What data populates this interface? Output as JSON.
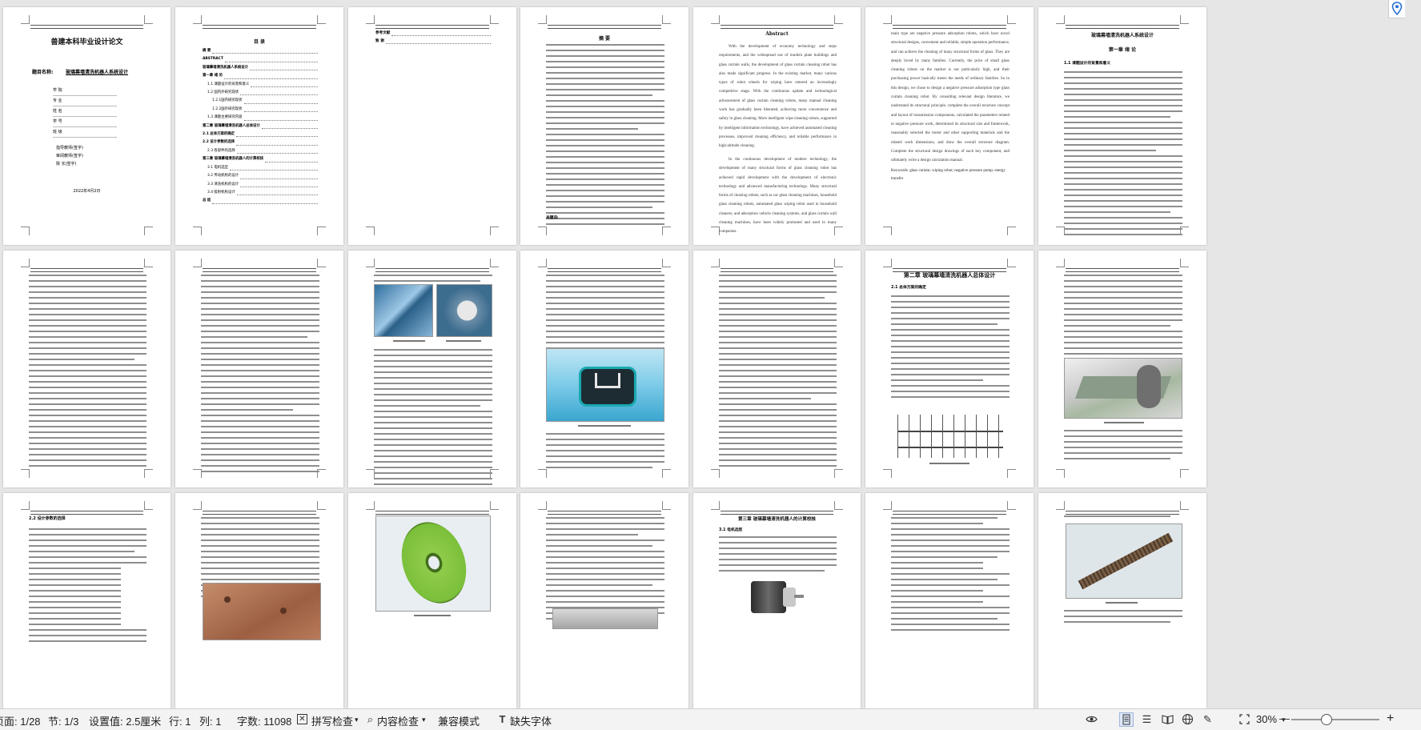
{
  "pages": {
    "cover": {
      "title": "兽建本科毕业设计论文",
      "topic_label": "题目名称:",
      "topic": "玻璃幕墙清洗机器人系统设计",
      "fields": [
        "学 院",
        "专 业",
        "姓 名",
        "学 号",
        "班 级"
      ],
      "signatures": [
        "指导教师(签字)",
        "审阅教师(签字)",
        "院 长(签字)"
      ],
      "date": "2022年4月2日"
    },
    "toc": {
      "title": "目 录",
      "entries": [
        "摘 要",
        "ABSTRACT",
        "玻璃幕墙清洗机器人系统设计",
        "第一章 绪 论",
        "1.1 课题设计的背景和意义",
        "1.2 国内外研究现状",
        "1.2.1国内研究现状",
        "1.2.2国外研究现状",
        "1.3 课题主要研究内容",
        "第二章 玻璃幕墙清洗机器人总体设计",
        "2.1 总体方案的确定",
        "2.2 设计参数的选择",
        "2.3 各部件的选择",
        "第三章 玻璃幕墙清洗机器人的计算校核",
        "3.1 电机选型",
        "3.2 传动机构的设计",
        "3.3 清洗机构的设计",
        "3.4 吸附机构设计",
        "总 结"
      ]
    },
    "refs": {
      "entries": [
        "参考文献",
        "致 谢"
      ]
    },
    "abstract_cn": {
      "title": "摘 要",
      "keywords": "关键词:"
    },
    "abstract_en": {
      "title": "Abstract",
      "paragraphs": [
        "With the development of economy technology and steps requirements, and the widespread use of modern plate buildings and glass curtain walls, the development of glass curtain cleaning robot has also made significant progress. In the existing market, many various types of robot wheels for wiping have entered an increasingly competitive stage. With the continuous update and technological advancement of glass curtain cleaning robots, many manual cleaning work has gradually been liberated, achieving more convenience and safety in glass cleaning. More intelligent wipe cleaning robots, supported by intelligent information technology, have achieved automated cleaning processes, improved cleaning efficiency, and reliable performance in high-altitude cleaning.",
        "In the continuous development of modern technology, the development of many structural forms of glass cleaning robot has achieved rapid development with the development of electronic technology and advanced manufacturing technology. Many structural forms of cleaning robots, such as car glass cleaning machines, household glass cleaning robots, automated glass wiping robot used in household cleaners, and adsorption vehicle cleaning systems, and glass curtain wall cleaning machines, have been widely promoted and used in many companies."
      ]
    },
    "abstract_en_cont": {
      "paragraph": "main type are negative pressure adsorption robots, which have novel structural designs, convenient and reliable, simple operation performance, and can achieve the cleaning of many structural forms of glass. They are deeply loved by many families. Currently, the price of small glass cleaning robots on the market is not particularly high, and their purchasing power basically meets the needs of ordinary families. So in this design, we chose to design a negative pressure adsorption type glass curtain cleaning robot. By consulting relevant design literature, we understand its structural principle, complete the overall structure concept and layout of transmission components, calculated the parameters related to negative pressure work, determined its structural size and framework, reasonably selected the motor and other supporting materials and the related work dimensions, and draw the overall structure diagram. Complete the structural design drawings of each key component, and ultimately write a design calculation manual.",
      "keywords": "Keywords: glass curtain; wiping robot; negative pressure pump; energy transfer"
    },
    "chapter1": {
      "title": "玻璃幕墙清洗机器人系统设计",
      "chapter": "第一章 绪 论",
      "section": "1.1 课题设计的背景和意义"
    },
    "chapter2": {
      "chapter": "第二章 玻璃幕墙清洗机器人总体设计",
      "section": "2.1 总体方案的确定"
    },
    "section_2_2": {
      "section": "2.2 设计参数的选择"
    },
    "chapter3": {
      "chapter": "第三章 玻璃幕墙清洗机器人的计算校核",
      "section": "3.1 电机选型"
    }
  },
  "statusbar": {
    "page": "页面: 1/28",
    "section": "节: 1/3",
    "setting": "设置值: 2.5厘米",
    "row": "行: 1",
    "col": "列: 1",
    "words": "字数: 11098",
    "spellcheck": "拼写检查",
    "contentcheck": "内容检查",
    "compat": "兼容模式",
    "missing_font": "缺失字体",
    "zoom": "30%",
    "zoom_out": "—",
    "zoom_in": "+"
  },
  "colors": {
    "statusbar_bg": "#f3f3f3",
    "workspace_bg": "#e6e6e6",
    "accent": "#2b6fd6",
    "image_blue": "#2f8fb8",
    "image_teal": "#1a7f86",
    "image_green": "#7abf3a",
    "image_copper": "#b57b5a"
  }
}
